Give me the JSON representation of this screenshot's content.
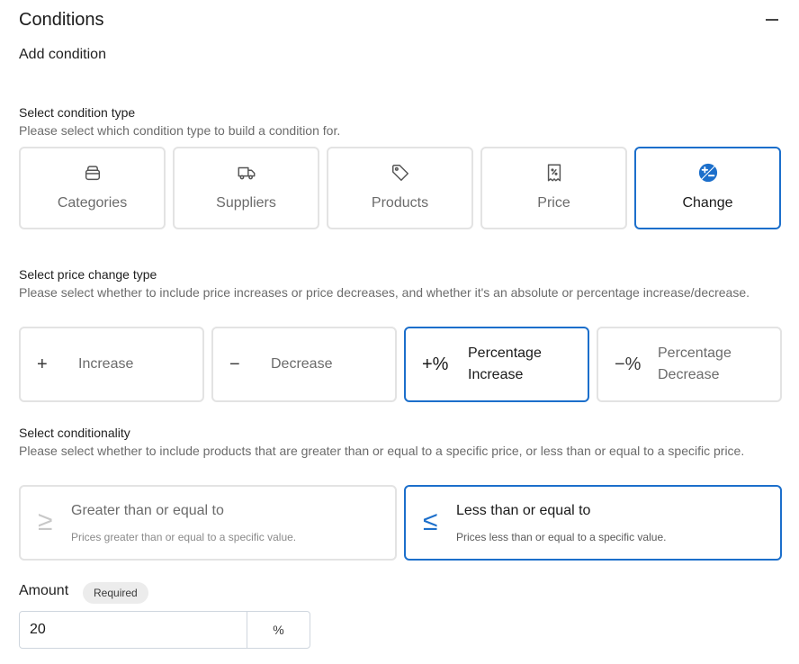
{
  "header": {
    "title": "Conditions",
    "collapse_icon": "minus-icon"
  },
  "add_condition": "Add condition",
  "condition_type": {
    "label": "Select condition type",
    "help": "Please select which condition type to build a condition for.",
    "options": [
      {
        "label": "Categories",
        "icon": "box-icon",
        "selected": false
      },
      {
        "label": "Suppliers",
        "icon": "truck-icon",
        "selected": false
      },
      {
        "label": "Products",
        "icon": "tag-icon",
        "selected": false
      },
      {
        "label": "Price",
        "icon": "receipt-icon",
        "selected": false
      },
      {
        "label": "Change",
        "icon": "plus-minus-circle-icon",
        "selected": true
      }
    ]
  },
  "change_type": {
    "label": "Select price change type",
    "help": "Please select whether to include price increases or price decreases, and whether it's an absolute or percentage increase/decrease.",
    "options": [
      {
        "symbol": "+",
        "label": "Increase",
        "selected": false
      },
      {
        "symbol": "−",
        "label": "Decrease",
        "selected": false
      },
      {
        "symbol": "+%",
        "label": "Percentage Increase",
        "selected": true
      },
      {
        "symbol": "−%",
        "label": "Percentage Decrease",
        "selected": false
      }
    ]
  },
  "conditionality": {
    "label": "Select conditionality",
    "help": "Please select whether to include products that are greater than or equal to a specific price, or less than or equal to a specific price.",
    "options": [
      {
        "symbol": "≥",
        "name": "Greater than or equal to",
        "desc": "Prices greater than or equal to a specific value.",
        "selected": false
      },
      {
        "symbol": "≤",
        "name": "Less than or equal to",
        "desc": "Prices less than or equal to a specific value.",
        "selected": true
      }
    ]
  },
  "amount": {
    "label": "Amount",
    "badge": "Required",
    "value": "20",
    "unit": "%"
  },
  "colors": {
    "accent": "#1c6fcb",
    "border": "#e3e3e3"
  }
}
